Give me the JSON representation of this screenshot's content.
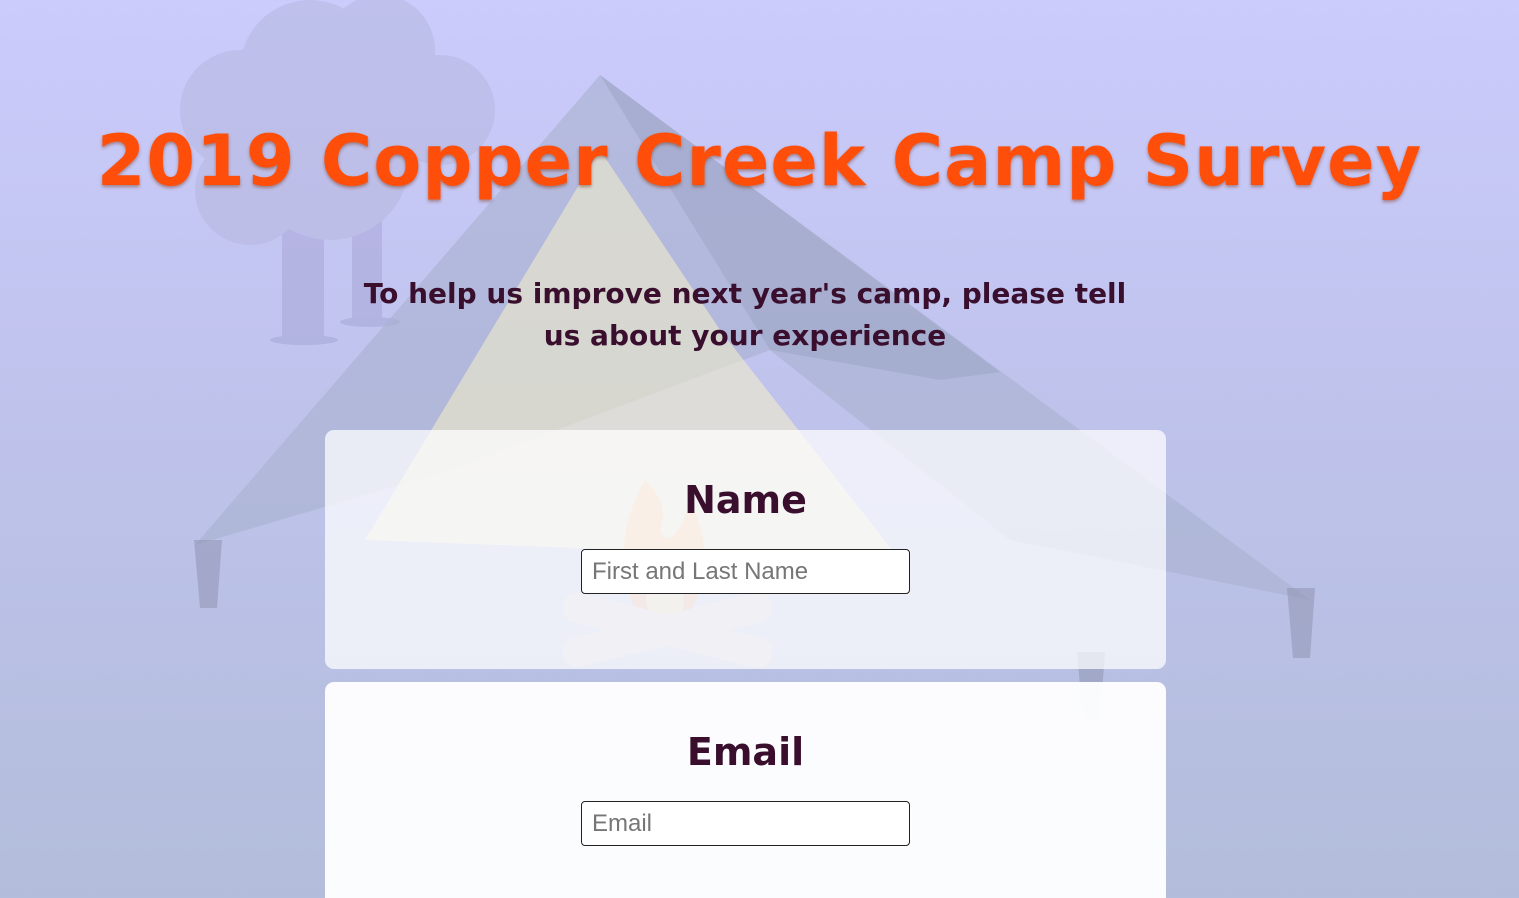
{
  "page": {
    "title": "2019 Copper Creek Camp Survey",
    "subtitle": "To help us improve next year's camp, please tell us about your experience"
  },
  "background": {
    "illustration": [
      "tree-icon",
      "tent-icon",
      "campfire-icon",
      "tent-stake-icon"
    ]
  },
  "form": {
    "name_question": {
      "label": "Name",
      "placeholder": "First and Last Name"
    },
    "email_question": {
      "label": "Email",
      "placeholder": "Email"
    }
  },
  "colors": {
    "title": "#ff4e0a",
    "text": "#3a0f2e",
    "background_top": "#cbcbfc",
    "background_bottom": "#b3bddb"
  }
}
